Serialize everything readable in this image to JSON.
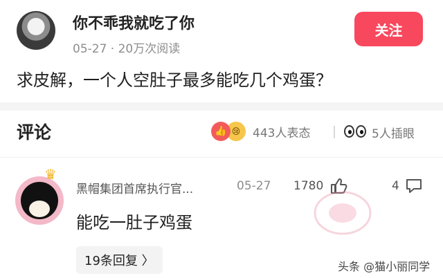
{
  "post": {
    "author": "你不乖我就吃了你",
    "meta": "05-27 · 20万次阅读",
    "follow_label": "关注",
    "question": "求皮解，一个人空肚子最多能吃几个鸡蛋？"
  },
  "comments": {
    "heading": "评论",
    "reactions": "443人表态",
    "stare": "5人插眼",
    "items": [
      {
        "name": "黑帽集团首席执行官...",
        "date": "05-27",
        "likes": "1780",
        "replies": "4",
        "text": "能吃一肚子鸡蛋",
        "more_replies": "19条回复 〉"
      }
    ]
  },
  "watermark": "头条 @猫小丽同学",
  "colors": {
    "accent": "#f8485e"
  },
  "icons": [
    "like-reaction-icon",
    "cry-reaction-icon",
    "eyes-icon",
    "thumb-up-icon",
    "reply-icon",
    "crown-icon"
  ]
}
